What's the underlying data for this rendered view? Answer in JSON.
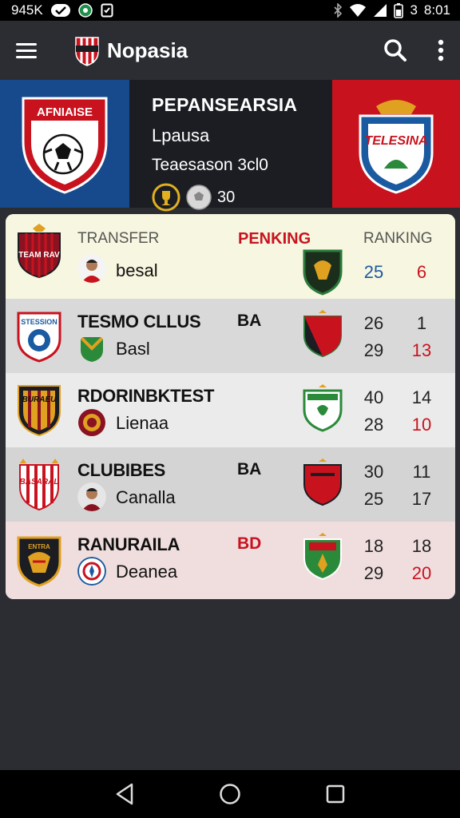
{
  "status_bar": {
    "network_text": "945K",
    "time": "8:01",
    "battery_level_text": "3"
  },
  "app_bar": {
    "title": "Nopasia",
    "icons": [
      "menu-icon",
      "search-icon",
      "more-vert-icon"
    ]
  },
  "hero": {
    "left_crest_text": "AFNIAISE",
    "right_crest_text": "TELESINA",
    "title": "PEPANSEARSIA",
    "subtitle": "Lpausa",
    "season": "Teaesason 3cl0",
    "count": "30"
  },
  "table": {
    "header": {
      "col1_label": "TRANSFER",
      "col2_label": "PENKING",
      "col3_label": "RANKING",
      "crest_text": "TEAM RAV",
      "sub": "besal",
      "n1": "25",
      "n2": "6"
    },
    "rows": [
      {
        "crest_text": "STESSION",
        "name": "TESMO CLLUS",
        "sub": "Basl",
        "code": "BA",
        "n1_top": "26",
        "n2_top": "1",
        "n1_bottom": "29",
        "n2_bottom": "13"
      },
      {
        "crest_text": "BURAEU",
        "name": "RDORINBKTEST",
        "sub": "Lienaa",
        "code": "",
        "n1_top": "40",
        "n2_top": "14",
        "n1_bottom": "28",
        "n2_bottom": "10"
      },
      {
        "crest_text": "BASARAL",
        "name": "CLUBIBES",
        "sub": "Canalla",
        "code": "BA",
        "n1_top": "30",
        "n2_top": "11",
        "n1_bottom": "25",
        "n2_bottom": "17"
      },
      {
        "crest_text": "ENTRA",
        "name": "RANURAILA",
        "sub": "Deanea",
        "code": "BD",
        "n1_top": "18",
        "n2_top": "18",
        "n1_bottom": "29",
        "n2_bottom": "20"
      }
    ]
  },
  "colors": {
    "blue_accent": "#174a8c",
    "red_accent": "#c8131f",
    "dark_bg": "#2b2d33"
  }
}
